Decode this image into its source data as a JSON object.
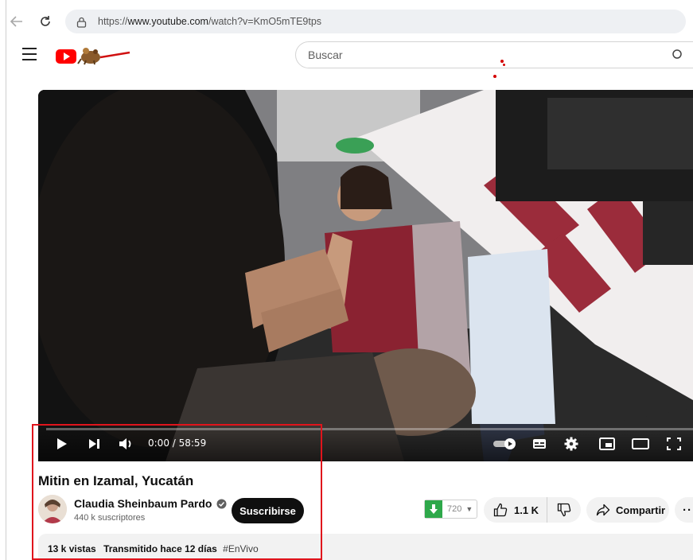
{
  "browser": {
    "url_prefix": "https://",
    "url_domain": "www.youtube.com",
    "url_path": "/watch?v=KmO5mTE9tps"
  },
  "masthead": {
    "search_placeholder": "Buscar"
  },
  "player": {
    "time_display": "0:00 / 58:59",
    "progress": 0
  },
  "video": {
    "title": "Mitin en Izamal, Yucatán",
    "channel_name": "Claudia Sheinbaum Pardo",
    "subscribers": "440 k suscriptores",
    "subscribe_label": "Suscribirse",
    "dislike_ext_count": "720",
    "like_count": "1.1 K",
    "share_label": "Compartir",
    "more_label": "···",
    "views": "13 k vistas",
    "streamed": "Transmitido hace 12 días",
    "hashtag": "#EnVivo"
  },
  "colors": {
    "youtube_red": "#ff0000",
    "subscribe_bg": "#0f0f0f",
    "highlight_border": "#e0141c",
    "ext_green": "#2ea84a"
  }
}
